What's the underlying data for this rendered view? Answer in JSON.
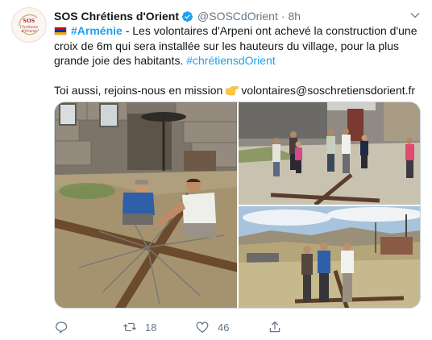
{
  "account": {
    "display_name": "SOS Chrétiens d'Orient",
    "handle": "@SOSCdOrient",
    "separator": "·",
    "time": "8h",
    "avatar_top": "SOS",
    "avatar_bottom": "Chrétiens d'Orient"
  },
  "tweet": {
    "hashtag_armenie": "#Arménie",
    "body_part1": " - Les volontaires d'Arpeni ont achevé la construction d'une croix de 6m qui sera installée sur les hauteurs du village, pour la plus grande joie des habitants. ",
    "hashtag_chretiens": "#chrétiensdOrient",
    "line2_text": "Toi aussi, rejoins-nous en mission",
    "email": "volontaires@soschretiensdorient.fr"
  },
  "actions": {
    "reply_count": "",
    "retweet_count": "18",
    "like_count": "46"
  },
  "colors": {
    "link": "#1da1f2",
    "secondary_text": "#657786",
    "verified": "#1da1f2",
    "flag": [
      "#d90012",
      "#0033a0",
      "#f2a800"
    ]
  },
  "icons": [
    "verified-badge-icon",
    "chevron-down-icon",
    "armenia-flag-icon",
    "pointing-hand-icon",
    "reply-icon",
    "retweet-icon",
    "like-icon",
    "share-icon"
  ]
}
